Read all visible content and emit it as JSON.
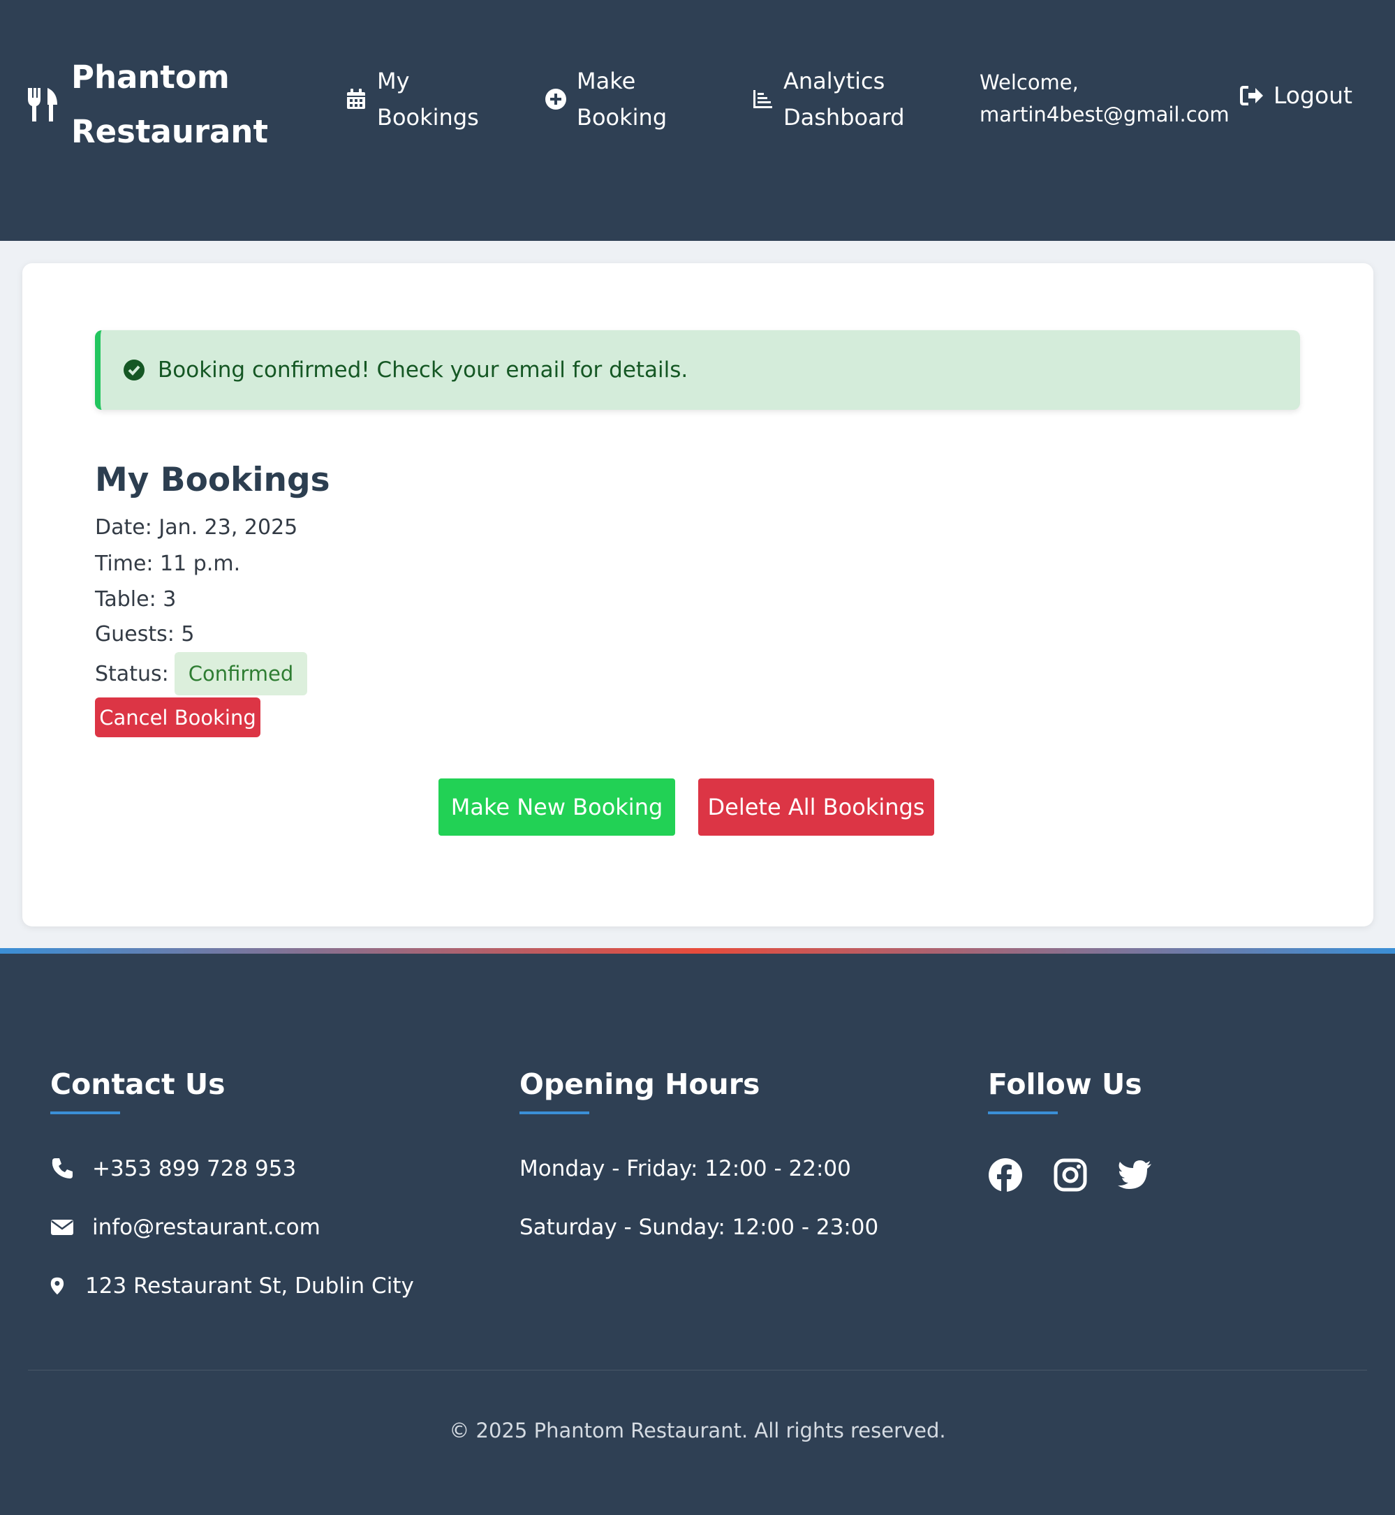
{
  "brand": {
    "icon": "utensils-icon",
    "name": "Phantom Restaurant"
  },
  "nav": {
    "items": [
      {
        "label": "My Bookings",
        "icon": "calendar-icon"
      },
      {
        "label": "Make Booking",
        "icon": "plus-circle-icon"
      },
      {
        "label": "Analytics Dashboard",
        "icon": "chart-icon"
      }
    ],
    "welcome": "Welcome, martin4best@gmail.com",
    "logout": {
      "label": "Logout",
      "icon": "sign-out-icon"
    }
  },
  "alert": {
    "icon": "check-circle-icon",
    "message": "Booking confirmed! Check your email for details."
  },
  "bookings": {
    "title": "My Bookings",
    "items": [
      {
        "date": "Date: Jan. 23, 2025",
        "time": "Time: 11 p.m.",
        "table": "Table: 3",
        "guests": "Guests: 5",
        "status_label": "Status:",
        "status": "Confirmed",
        "cancel_label": "Cancel Booking"
      }
    ],
    "make_new_label": "Make New Booking",
    "delete_all_label": "Delete All Bookings"
  },
  "footer": {
    "contact": {
      "title": "Contact Us",
      "phone": "+353 899 728 953",
      "email": "info@restaurant.com",
      "address": "123 Restaurant St, Dublin City"
    },
    "hours": {
      "title": "Opening Hours",
      "weekdays": "Monday - Friday: 12:00 - 22:00",
      "weekend": "Saturday - Sunday: 12:00 - 23:00"
    },
    "follow": {
      "title": "Follow Us",
      "icons": [
        "facebook-icon",
        "instagram-icon",
        "twitter-icon"
      ]
    },
    "copyright": "© 2025 Phantom Restaurant. All rights reserved."
  },
  "colors": {
    "navbar_bg": "#2f4054",
    "success": "#22d155",
    "danger": "#dc3545",
    "accent_blue": "#3b8fd6",
    "alert_bg": "#d4ecda"
  }
}
